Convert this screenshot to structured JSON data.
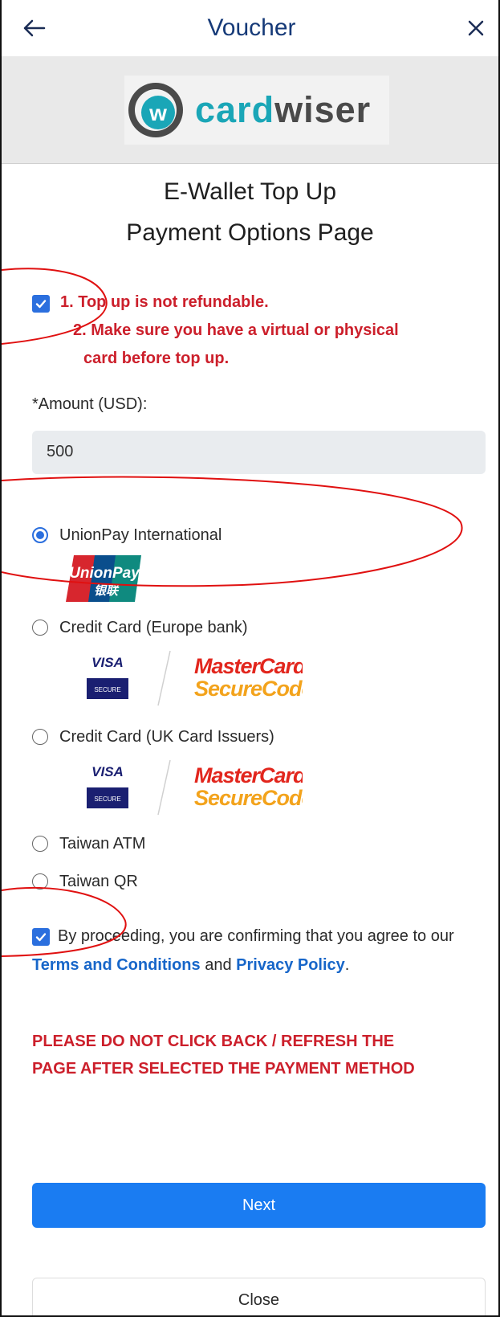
{
  "header": {
    "back_icon": "arrow-left-icon",
    "title": "Voucher",
    "close_icon": "close-icon"
  },
  "brand": {
    "logo_card": "card",
    "logo_wiser": "wiser",
    "accent": "#1aa6b7"
  },
  "page": {
    "title_line1": "E-Wallet Top Up",
    "title_line2": "Payment Options Page"
  },
  "notice": {
    "checked": true,
    "line1": "1. Top up is not refundable.",
    "line2": "2. Make sure you have a virtual or physical",
    "line3": "card before top up."
  },
  "amount": {
    "label": "*Amount (USD):",
    "value": "500"
  },
  "payment_options": [
    {
      "label": "UnionPay International",
      "selected": true
    },
    {
      "label": "Credit Card (Europe bank)",
      "selected": false
    },
    {
      "label": "Credit Card (UK Card Issuers)",
      "selected": false
    },
    {
      "label": "Taiwan ATM",
      "selected": false
    },
    {
      "label": "Taiwan QR",
      "selected": false
    }
  ],
  "card_logos": {
    "unionpay_en": "UnionPay",
    "unionpay_cn": "银联",
    "visa": "VISA",
    "visa_secure": "SECURE",
    "mastercard": "MasterCard.",
    "securecode": "SecureCode."
  },
  "agreement": {
    "checked": true,
    "text_before": "By proceeding, you are confirming that you agree to our",
    "terms_link": "Terms and Conditions",
    "and_text": "and",
    "privacy_link": "Privacy Policy",
    "end_text": "."
  },
  "warning": {
    "line1": "PLEASE DO NOT CLICK BACK / REFRESH THE",
    "line2": "PAGE AFTER SELECTED THE PAYMENT METHOD"
  },
  "buttons": {
    "next": "Next",
    "close": "Close"
  },
  "colors": {
    "primary": "#1a7cf2",
    "warning": "#cc1f2b",
    "link": "#1766c9",
    "annotation": "#e01010"
  }
}
